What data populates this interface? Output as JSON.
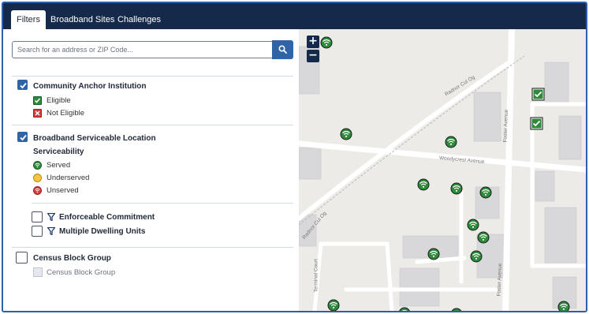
{
  "tabs": [
    {
      "label": "Filters",
      "active": true
    },
    {
      "label": "Broadband Sites",
      "active": false
    },
    {
      "label": "Challenges",
      "active": false
    }
  ],
  "search": {
    "placeholder": "Search for an address or ZIP Code...",
    "value": "",
    "button_icon": "search-icon"
  },
  "filters": {
    "anchor": {
      "label": "Community Anchor Institution",
      "checked": true,
      "legend": [
        {
          "label": "Eligible",
          "color": "#2d8a3a",
          "icon": "check-square-icon"
        },
        {
          "label": "Not Eligible",
          "color": "#d53a3a",
          "icon": "x-square-icon"
        }
      ]
    },
    "bsl": {
      "label": "Broadband Serviceable Location",
      "checked": true,
      "subheading": "Serviceability",
      "legend": [
        {
          "label": "Served",
          "color": "#2d8a3a"
        },
        {
          "label": "Underserved",
          "color": "#f4c542"
        },
        {
          "label": "Unserved",
          "color": "#d53a3a"
        }
      ]
    },
    "enforceable": {
      "label": "Enforceable Commitment",
      "checked": false,
      "icon": "funnel-icon"
    },
    "mdu": {
      "label": "Multiple Dwelling Units",
      "checked": false,
      "icon": "funnel-icon"
    },
    "census": {
      "label": "Census Block Group",
      "checked": false,
      "legend": [
        {
          "label": "Census Block Group",
          "color": "#e5e7ee"
        }
      ]
    }
  },
  "map": {
    "zoom_in": "+",
    "zoom_out": "−",
    "roads": [
      "Radnor Cul Og",
      "Woodycrest Avenue",
      "Foster Avenue",
      "Radnor Cul Og",
      "Terminal Court",
      "Foster Avenue"
    ],
    "colors": {
      "served": "#2d8a3a",
      "anchor": "#2d8a3a",
      "road": "#ffffff",
      "building": "#d8d8da"
    }
  }
}
